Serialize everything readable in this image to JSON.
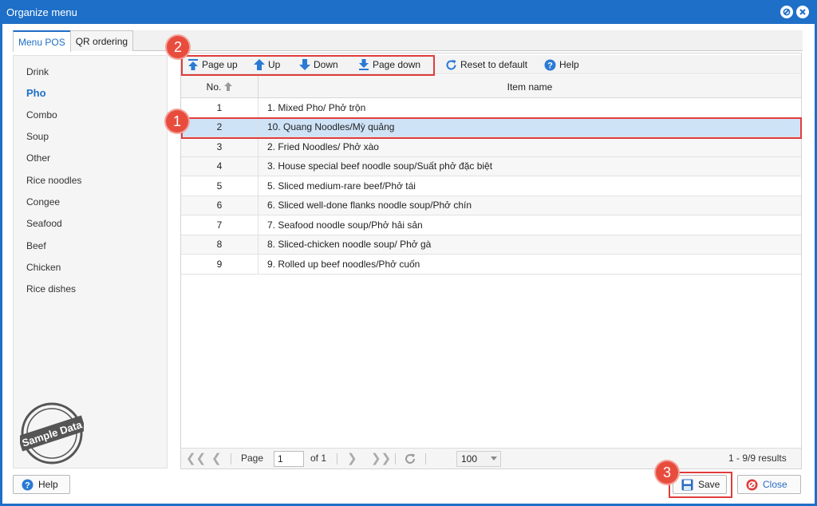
{
  "window": {
    "title": "Organize menu"
  },
  "tabs": [
    {
      "label": "Menu POS"
    },
    {
      "label": "QR ordering"
    }
  ],
  "categories": [
    "Drink",
    "Pho",
    "Combo",
    "Soup",
    "Other",
    "Rice noodles",
    "Congee",
    "Seafood",
    "Beef",
    "Chicken",
    "Rice dishes"
  ],
  "active_category": "Pho",
  "stamp": "Sample Data",
  "toolbar": {
    "page_up": "Page up",
    "up": "Up",
    "down": "Down",
    "page_down": "Page down",
    "reset": "Reset to default",
    "help": "Help"
  },
  "grid": {
    "col_no": "No.",
    "col_name": "Item name",
    "rows": [
      {
        "no": "1",
        "name": "1. Mixed Pho/ Phở trộn"
      },
      {
        "no": "2",
        "name": "10. Quang Noodles/Mỳ quảng"
      },
      {
        "no": "3",
        "name": "2. Fried Noodles/ Phở xào"
      },
      {
        "no": "4",
        "name": "3. House special beef noodle soup/Suất phở đặc biệt"
      },
      {
        "no": "5",
        "name": "5. Sliced medium-rare beef/Phở tái"
      },
      {
        "no": "6",
        "name": "6. Sliced well-done flanks noodle soup/Phở chín"
      },
      {
        "no": "7",
        "name": "7. Seafood noodle soup/Phở hải sản"
      },
      {
        "no": "8",
        "name": "8. Sliced-chicken noodle soup/ Phở gà"
      },
      {
        "no": "9",
        "name": "9. Rolled up beef noodles/Phở cuốn"
      }
    ]
  },
  "pager": {
    "page_label": "Page",
    "page_value": "1",
    "of_label": "of 1",
    "page_size": "100",
    "results": "1 - 9/9 results"
  },
  "footer": {
    "help": "Help",
    "save": "Save",
    "close": "Close"
  },
  "callouts": [
    "1",
    "2",
    "3"
  ],
  "colors": {
    "accent": "#1e6fc7",
    "highlight": "#e03c3c",
    "selected_row": "#cfe3f7"
  }
}
